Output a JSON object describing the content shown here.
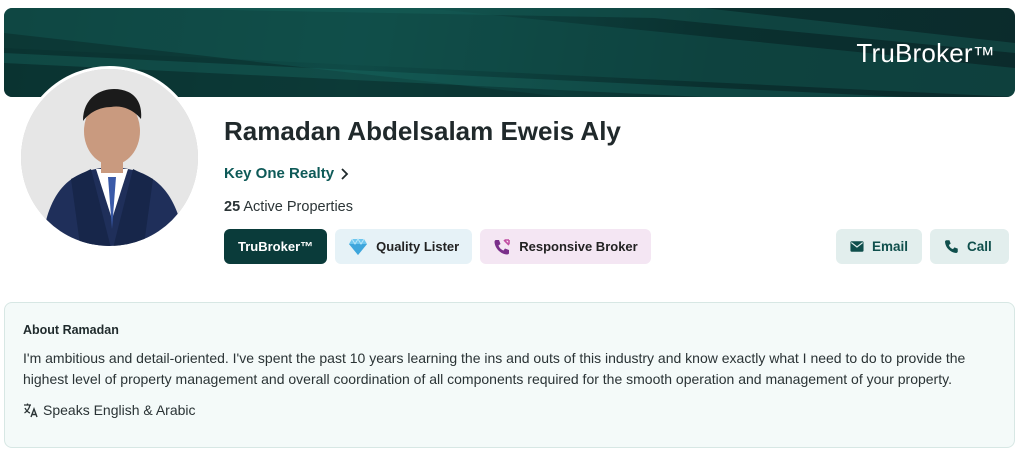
{
  "banner": {
    "brand": "TruBroker",
    "trademark": "™"
  },
  "agent": {
    "name": "Ramadan Abdelsalam Eweis Aly",
    "agency": "Key One Realty",
    "active_count": "25",
    "active_label": "Active Properties"
  },
  "badges": {
    "trubroker": "TruBroker™",
    "quality": "Quality Lister",
    "responsive": "Responsive Broker"
  },
  "actions": {
    "email": "Email",
    "call": "Call"
  },
  "about": {
    "title": "About Ramadan",
    "text": "I'm ambitious and detail-oriented. I've spent the past 10 years learning the ins and outs of this industry and know exactly what I need to do to provide the highest level of property management and overall coordination of all components required for the smooth operation and management of your property.",
    "languages": "Speaks English & Arabic"
  },
  "colors": {
    "brand_dark": "#0a3b3a",
    "accent_teal": "#0e5a58",
    "button_bg": "#e2eeed",
    "quality_bg": "#e6f2f7",
    "responsive_bg": "#f4e6f3"
  },
  "icons": {
    "agency": "chevron-right-icon",
    "quality": "diamond-icon",
    "responsive": "phone-call-icon",
    "email": "mail-icon",
    "call": "phone-icon",
    "language": "translate-icon"
  }
}
